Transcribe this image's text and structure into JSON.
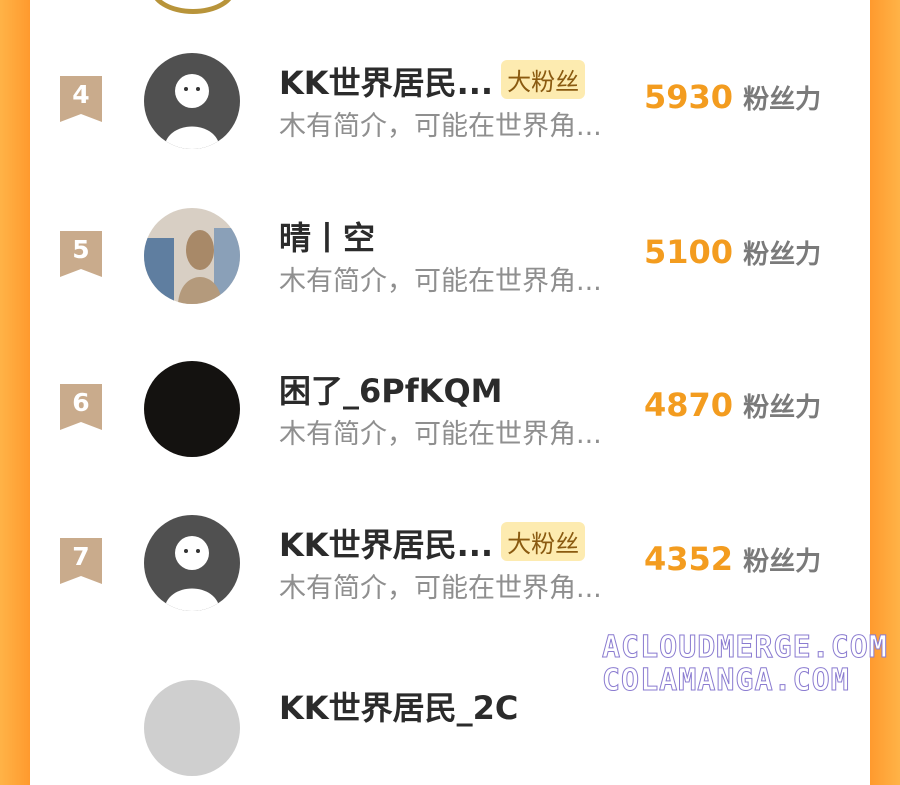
{
  "rows": [
    {
      "rank": "4",
      "name": "KK世界居民...",
      "badge": "大粉丝",
      "bio": "木有简介，可能在世界角...",
      "score": "5930",
      "unit": "粉丝力",
      "avatar": "default-avatar"
    },
    {
      "rank": "5",
      "name": "晴丨空",
      "badge": "",
      "bio": "木有简介，可能在世界角...",
      "score": "5100",
      "unit": "粉丝力",
      "avatar": "photo-avatar"
    },
    {
      "rank": "6",
      "name": "困了_6PfKQM",
      "badge": "",
      "bio": "木有简介，可能在世界角...",
      "score": "4870",
      "unit": "粉丝力",
      "avatar": "dark-avatar"
    },
    {
      "rank": "7",
      "name": "KK世界居民...",
      "badge": "大粉丝",
      "bio": "木有简介，可能在世界角...",
      "score": "4352",
      "unit": "粉丝力",
      "avatar": "default-avatar"
    }
  ],
  "partial_row": {
    "name": "KK世界居民_2C"
  },
  "watermark": {
    "line1": "ACLOUDMERGE.COM",
    "line2": "COLAMANGA.COM"
  },
  "colors": {
    "rank_ribbon": "#c9ab8c",
    "score": "#f39c1f",
    "side": "#ff9a2e"
  }
}
